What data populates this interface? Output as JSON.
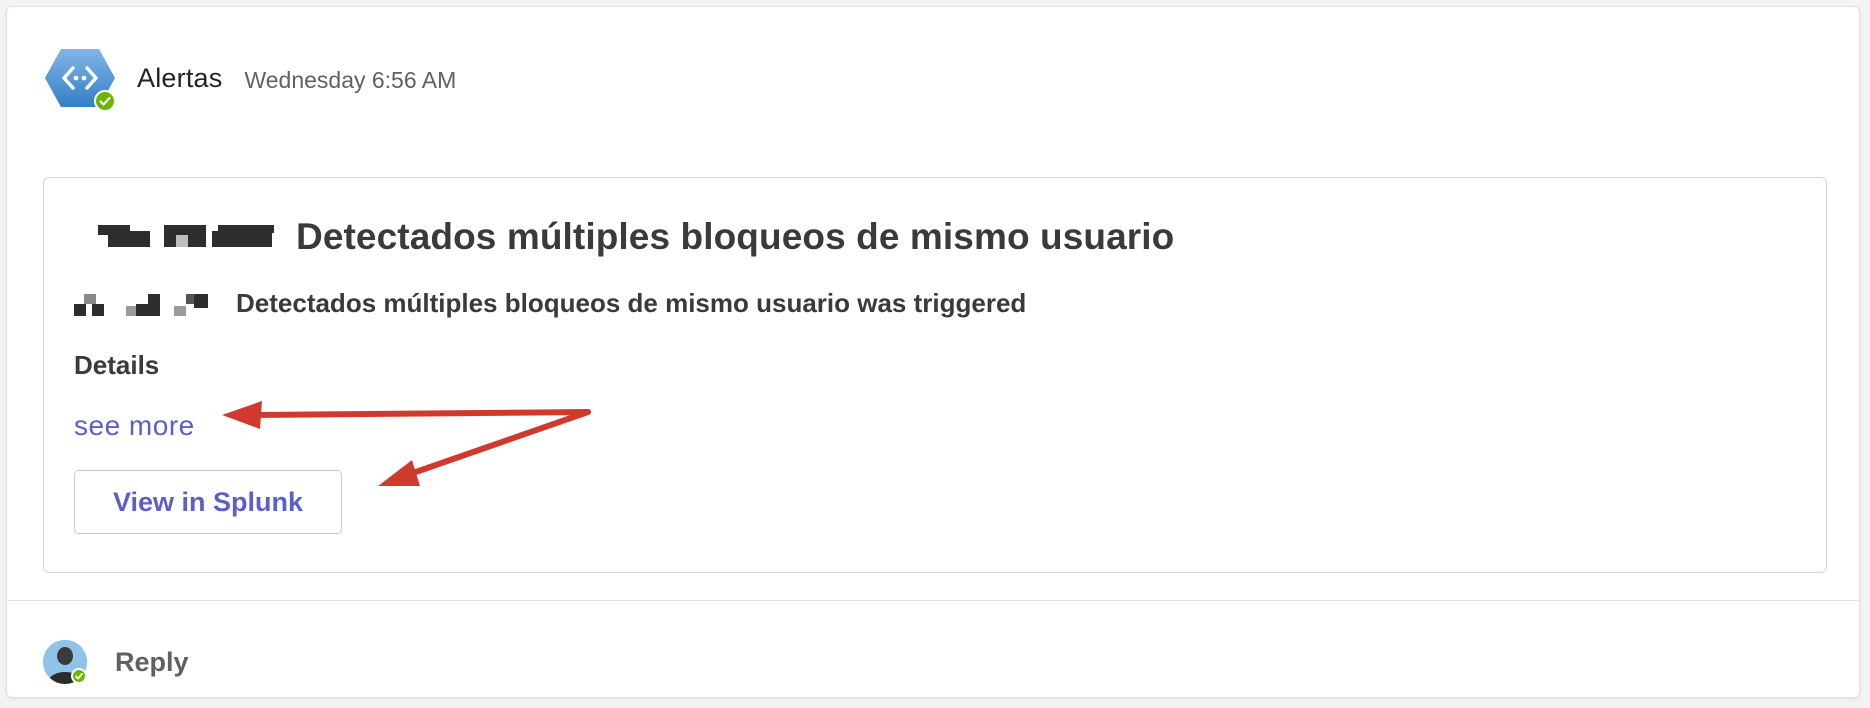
{
  "message": {
    "sender": "Alertas",
    "timestamp": "Wednesday 6:56 AM"
  },
  "card": {
    "title": "Detectados múltiples bloqueos de mismo usuario",
    "subtitle": "Detectados múltiples bloqueos de mismo usuario was triggered",
    "details_label": "Details",
    "see_more_label": "see more",
    "view_button_label": "View in Splunk"
  },
  "reply": {
    "label": "Reply"
  },
  "colors": {
    "accent": "#5b5fc7",
    "presence": "#6bb700",
    "annotation_arrow": "#d03a2e",
    "app_icon": "#3f8fd8"
  },
  "icons": {
    "app": "bot-app-icon",
    "presence": "presence-available-icon",
    "annotation": "red-arrow-annotation"
  }
}
